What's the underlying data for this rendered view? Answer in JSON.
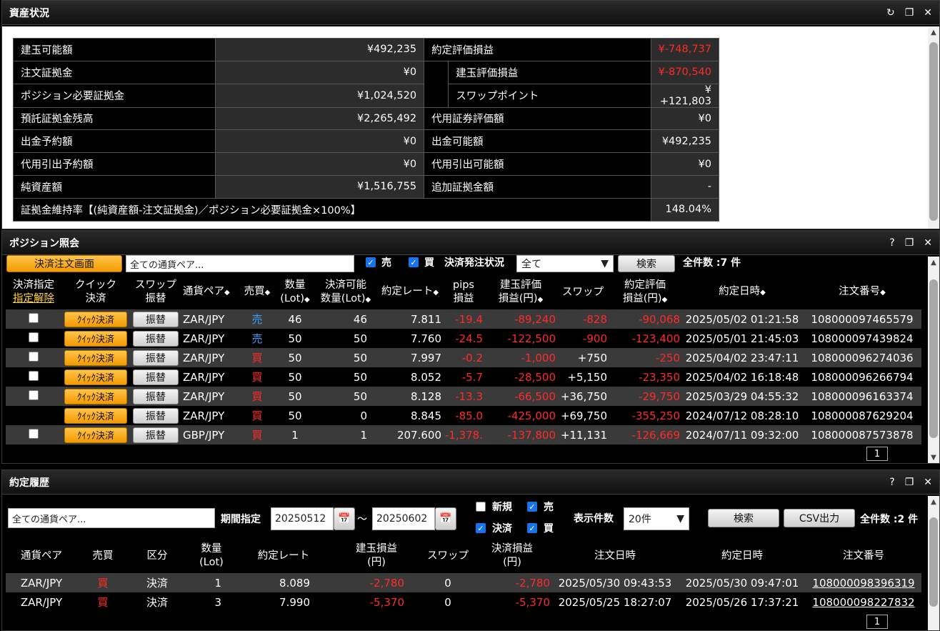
{
  "asset": {
    "title": "資産状況",
    "rows": [
      {
        "l1": "建玉可能額",
        "v1": "¥492,235",
        "l2": "約定評価損益",
        "v2": "¥-748,737",
        "v2red": true
      },
      {
        "l1": "注文証拠金",
        "v1": "¥0",
        "l2": "建玉評価損益",
        "v2": "¥-870,540",
        "v2red": true
      },
      {
        "l1": "ポジション必要証拠金",
        "v1": "¥1,024,520",
        "l2": "スワップポイント",
        "v2": "¥+121,803"
      },
      {
        "l1": "預託証拠金残高",
        "v1": "¥2,265,492",
        "l2": "代用証券評価額",
        "v2": "¥0"
      },
      {
        "l1": "出金予約額",
        "v1": "¥0",
        "l2": "出金可能額",
        "v2": "¥492,235"
      },
      {
        "l1": "代用引出予約額",
        "v1": "¥0",
        "l2": "代用引出可能額",
        "v2": "¥0"
      },
      {
        "l1": "純資産額",
        "v1": "¥1,516,755",
        "l2": "追加証拠金額",
        "v2": "-"
      }
    ],
    "ratio_label": "証拠金維持率【(純資産額-注文証拠金)／ポジション必要証拠金×100%】",
    "ratio_value": "148.04%"
  },
  "position": {
    "title": "ポジション照会",
    "settle_screen_btn": "決済注文画面",
    "pair_placeholder": "全ての通貨ペア...",
    "sell_label": "売",
    "buy_label": "買",
    "status_label": "決済発注状況",
    "status_value": "全て",
    "search_btn": "検索",
    "count_text": "全件数 :7 件",
    "headers": {
      "settle_select": "決済指定",
      "unselect": "指定解除",
      "quick1": "クイック",
      "quick2": "決済",
      "swap1": "スワップ",
      "swap2": "振替",
      "pair": "通貨ペア",
      "side": "売買",
      "qty1": "数量",
      "qty2": "(Lot)",
      "avail1": "決済可能",
      "avail2": "数量(Lot)",
      "rate": "約定レート",
      "pips1": "pips",
      "pips2": "損益",
      "eval1": "建玉評価",
      "eval2": "損益(円)",
      "swap": "スワップ",
      "exec1": "約定評価",
      "exec2": "損益(円)",
      "date": "約定日時",
      "order": "注文番号"
    },
    "quick_btn": "ｸｲｯｸ決済",
    "transfer_btn": "振替",
    "rows": [
      {
        "chk": true,
        "pair": "ZAR/JPY",
        "side": "売",
        "sell": true,
        "qty": "46",
        "avail": "46",
        "rate": "7.811",
        "pips": "-19.4",
        "eval": "-89,240",
        "swap": "-828",
        "swapred": true,
        "exec": "-90,068",
        "date": "2025/05/02 01:21:58",
        "order": "108000097465579"
      },
      {
        "chk": true,
        "pair": "ZAR/JPY",
        "side": "売",
        "sell": true,
        "qty": "50",
        "avail": "50",
        "rate": "7.760",
        "pips": "-24.5",
        "eval": "-122,500",
        "swap": "-900",
        "swapred": true,
        "exec": "-123,400",
        "date": "2025/05/01 21:45:03",
        "order": "108000097439824"
      },
      {
        "chk": true,
        "pair": "ZAR/JPY",
        "side": "買",
        "sell": false,
        "qty": "50",
        "avail": "50",
        "rate": "7.997",
        "pips": "-0.2",
        "eval": "-1,000",
        "swap": "+750",
        "swapred": false,
        "exec": "-250",
        "date": "2025/04/02 23:47:11",
        "order": "108000096274036"
      },
      {
        "chk": true,
        "pair": "ZAR/JPY",
        "side": "買",
        "sell": false,
        "qty": "50",
        "avail": "50",
        "rate": "8.052",
        "pips": "-5.7",
        "eval": "-28,500",
        "swap": "+5,150",
        "swapred": false,
        "exec": "-23,350",
        "date": "2025/04/02 16:18:48",
        "order": "108000096266794"
      },
      {
        "chk": true,
        "pair": "ZAR/JPY",
        "side": "買",
        "sell": false,
        "qty": "50",
        "avail": "50",
        "rate": "8.128",
        "pips": "-13.3",
        "eval": "-66,500",
        "swap": "+36,750",
        "swapred": false,
        "exec": "-29,750",
        "date": "2025/03/29 04:55:32",
        "order": "108000096163374"
      },
      {
        "chk": false,
        "pair": "ZAR/JPY",
        "side": "買",
        "sell": false,
        "qty": "50",
        "avail": "0",
        "rate": "8.845",
        "pips": "-85.0",
        "eval": "-425,000",
        "swap": "+69,750",
        "swapred": false,
        "exec": "-355,250",
        "date": "2024/07/12 08:28:10",
        "order": "108000087629204"
      },
      {
        "chk": true,
        "pair": "GBP/JPY",
        "side": "買",
        "sell": false,
        "qty": "1",
        "avail": "1",
        "rate": "207.600",
        "pips": "-1,378.",
        "eval": "-137,800",
        "swap": "+11,131",
        "swapred": false,
        "exec": "-126,669",
        "date": "2024/07/11 09:32:00",
        "order": "108000087573878"
      }
    ],
    "page": "1"
  },
  "history": {
    "title": "約定履歴",
    "pair_placeholder": "全ての通貨ペア...",
    "period_label": "期間指定",
    "from": "20250512",
    "tilde": "～",
    "to": "20250602",
    "new_label": "新規",
    "sell_label": "売",
    "settle_label": "決済",
    "buy_label": "買",
    "display_count_label": "表示件数",
    "display_count_value": "20件",
    "search_btn": "検索",
    "csv_btn": "CSV出力",
    "count_text": "全件数 :2 件",
    "headers": {
      "pair": "通貨ペア",
      "side": "売買",
      "kind": "区分",
      "qty1": "数量",
      "qty2": "(Lot)",
      "rate": "約定レート",
      "pl1": "建玉損益",
      "pl2": "(円)",
      "swap": "スワップ",
      "spl1": "決済損益",
      "spl2": "(円)",
      "odate": "注文日時",
      "edate": "約定日時",
      "order": "注文番号"
    },
    "rows": [
      {
        "pair": "ZAR/JPY",
        "side": "買",
        "kind": "決済",
        "qty": "1",
        "rate": "8.089",
        "pl": "-2,780",
        "swap": "0",
        "spl": "-2,780",
        "odate": "2025/05/30 09:43:53",
        "edate": "2025/05/30 09:47:01",
        "order": "108000098396319"
      },
      {
        "pair": "ZAR/JPY",
        "side": "買",
        "kind": "決済",
        "qty": "3",
        "rate": "7.990",
        "pl": "-5,370",
        "swap": "0",
        "spl": "-5,370",
        "odate": "2025/05/25 18:27:07",
        "edate": "2025/05/26 17:37:21",
        "order": "108000098227832"
      }
    ],
    "page": "1"
  },
  "icons": {
    "refresh": "refresh-icon",
    "restore": "restore-icon",
    "close": "close-icon",
    "help": "help-icon",
    "calendar": "calendar-icon"
  }
}
